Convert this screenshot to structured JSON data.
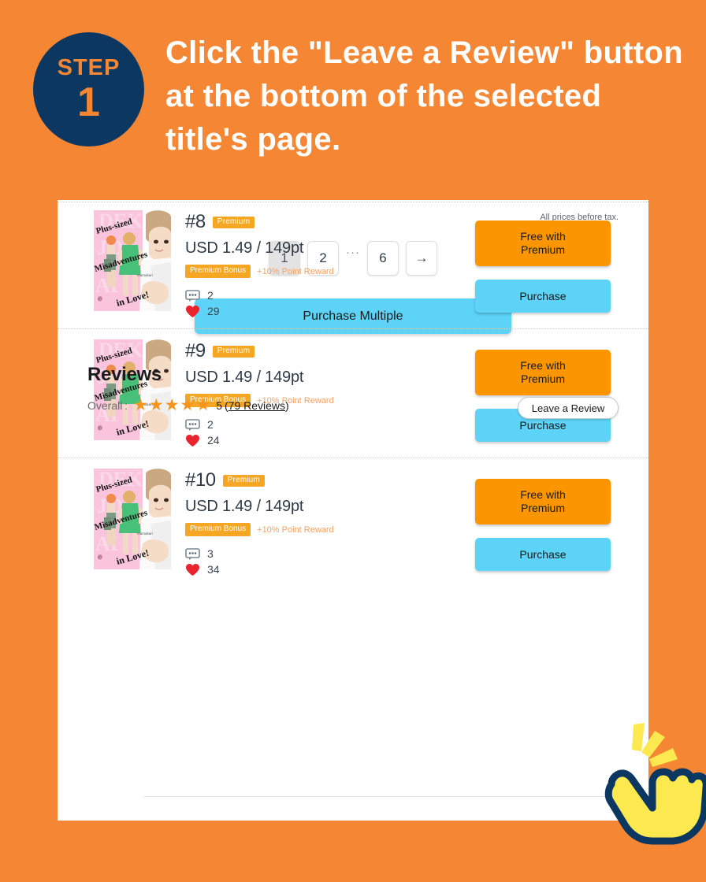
{
  "header": {
    "step_word": "STEP",
    "step_number": "1",
    "instruction": "Click the \"Leave a Review\" button at the bottom of the selected title's page.",
    "badge_bg": "#0B3761",
    "badge_text_color": "#F58634",
    "page_bg": "#F58634"
  },
  "volumes": [
    {
      "number": "#8",
      "premium_badge": "Premium",
      "price": "USD 1.49 / 149pt",
      "bonus_badge": "Premium Bonus",
      "bonus_text": "+10% Point Reward",
      "comments": "2",
      "likes": "29",
      "free_button": "Free with Premium",
      "purchase_button": "Purchase",
      "cover_title_1": "Plus-sized",
      "cover_title_2": "Misadventures",
      "cover_title_3": "in Love!",
      "cover_author": "mamakari"
    },
    {
      "number": "#9",
      "premium_badge": "Premium",
      "price": "USD 1.49 / 149pt",
      "bonus_badge": "Premium Bonus",
      "bonus_text": "+10% Point Reward",
      "comments": "2",
      "likes": "24",
      "free_button": "Free with Premium",
      "purchase_button": "Purchase",
      "cover_title_1": "Plus-sized",
      "cover_title_2": "Misadventures",
      "cover_title_3": "in Love!",
      "cover_author": "mamakari"
    },
    {
      "number": "#10",
      "premium_badge": "Premium",
      "price": "USD 1.49 / 149pt",
      "bonus_badge": "Premium Bonus",
      "bonus_text": "+10% Point Reward",
      "comments": "3",
      "likes": "34",
      "free_button": "Free with Premium",
      "purchase_button": "Purchase",
      "cover_title_1": "Plus-sized",
      "cover_title_2": "Misadventures",
      "cover_title_3": "in Love!",
      "cover_author": "mamakari"
    }
  ],
  "tax_note": "All prices before tax.",
  "pagination": {
    "pages": [
      "1",
      "2"
    ],
    "ellipsis": "···",
    "last_page": "6",
    "next_arrow": "→",
    "active_index": 0
  },
  "purchase_multiple": "Purchase Multiple",
  "reviews": {
    "title": "Reviews",
    "overall_label": "Overall :",
    "stars_filled": 5,
    "star_glyph": "★",
    "score": "5",
    "count_open": "(",
    "count_link": "79 Reviews",
    "count_close": ")",
    "leave_button": "Leave a Review",
    "star_color": "#F7941E"
  },
  "colors": {
    "orange_bg": "#F58634",
    "navy": "#0B3761",
    "premium_orange": "#FB9500",
    "purchase_blue": "#5CD3F7",
    "badge_orange": "#F5A623",
    "heart_red": "#E8252C",
    "cursor_yellow": "#FCE94F",
    "cursor_outline": "#0B3761"
  }
}
